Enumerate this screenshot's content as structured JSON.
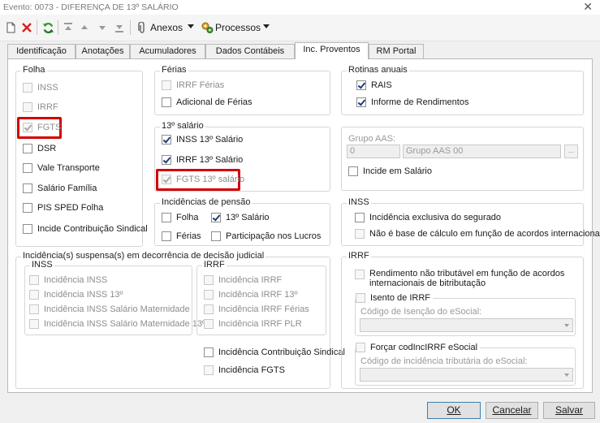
{
  "window": {
    "title": "Evento: 0073 - DIFERENÇA DE 13º SALÁRIO",
    "close_glyph": "✕"
  },
  "toolbar": {
    "new_icon": "new-document-icon",
    "delete_icon": "delete-x-icon",
    "refresh_icon": "refresh-icon",
    "first_icon": "first-record-icon",
    "prev_icon": "previous-record-icon",
    "next_icon": "next-record-icon",
    "last_icon": "last-record-icon",
    "anexos_label": "Anexos",
    "processos_label": "Processos"
  },
  "tabs": [
    {
      "label": "Identificação",
      "active": false
    },
    {
      "label": "Anotações",
      "active": false
    },
    {
      "label": "Acumuladores",
      "active": false
    },
    {
      "label": "Dados Contábeis",
      "active": false
    },
    {
      "label": "Inc. Proventos",
      "active": true
    },
    {
      "label": "RM Portal",
      "active": false
    }
  ],
  "folha": {
    "title": "Folha",
    "items": [
      {
        "label": "INSS",
        "checked": false,
        "enabled": false
      },
      {
        "label": "IRRF",
        "checked": false,
        "enabled": false
      },
      {
        "label": "FGTS",
        "checked": true,
        "enabled": false,
        "highlighted": true
      },
      {
        "label": "DSR",
        "checked": false,
        "enabled": true
      },
      {
        "label": "Vale Transporte",
        "checked": false,
        "enabled": true
      },
      {
        "label": "Salário Família",
        "checked": false,
        "enabled": true
      },
      {
        "label": "PIS SPED Folha",
        "checked": false,
        "enabled": true
      },
      {
        "label": "Incide Contribuição Sindical",
        "checked": false,
        "enabled": true
      }
    ]
  },
  "ferias": {
    "title": "Férias",
    "items": [
      {
        "label": "IRRF Férias",
        "checked": false,
        "enabled": false
      },
      {
        "label": "Adicional de Férias",
        "checked": false,
        "enabled": true
      }
    ]
  },
  "decimo": {
    "title": "13º salário",
    "items": [
      {
        "label": "INSS 13º Salário",
        "checked": true,
        "enabled": true
      },
      {
        "label": "IRRF 13º Salário",
        "checked": true,
        "enabled": true
      },
      {
        "label": "FGTS 13º salário",
        "checked": true,
        "enabled": false,
        "highlighted": true
      }
    ]
  },
  "pensao": {
    "title": "Incidências de pensão",
    "folha": {
      "label": "Folha",
      "checked": false
    },
    "decimo": {
      "label": "13º Salário",
      "checked": true
    },
    "ferias": {
      "label": "Férias",
      "checked": false
    },
    "plr": {
      "label": "Participação nos Lucros",
      "checked": false
    }
  },
  "rotinas": {
    "title": "Rotinas anuais",
    "items": [
      {
        "label": "RAIS",
        "checked": true
      },
      {
        "label": "Informe de Rendimentos",
        "checked": true
      }
    ]
  },
  "grupo_aas": {
    "title": "Grupo AAS:",
    "code": "0",
    "name": "Grupo AAS 00",
    "lookup_label": "...",
    "incide": {
      "label": "Incide em Salário",
      "checked": false
    }
  },
  "inss": {
    "title": "INSS",
    "items": [
      {
        "label": "Incidência exclusiva do segurado",
        "checked": false,
        "enabled": true
      },
      {
        "label": "Não é base de cálculo em função de acordos internacionais",
        "checked": false,
        "enabled": false
      }
    ]
  },
  "suspensa": {
    "title": "Incidência(s) suspensa(s) em decorrência de decisão judicial",
    "inss_title": "INSS",
    "inss_items": [
      "Incidência INSS",
      "Incidência INSS 13º",
      "Incidência INSS Salário Maternidade",
      "Incidência INSS Salário Maternidade 13º"
    ],
    "irrf_title": "IRRF",
    "irrf_items": [
      "Incidência IRRF",
      "Incidência IRRF 13º",
      "Incidência IRRF Férias",
      "Incidência IRRF PLR"
    ],
    "sindical": "Incidência Contribuição Sindical",
    "fgts": "Incidência FGTS"
  },
  "irrf": {
    "title": "IRRF",
    "rendimento_line1": "Rendimento não tributável em função de acordos",
    "rendimento_line2": "internacionais de bitributação",
    "isento_label": "Isento de IRRF",
    "codigo_isencao_label": "Código de Isenção do eSocial:",
    "forcar_label": "Forçar codIncIRRF eSocial",
    "codigo_incidencia_label": "Código de incidência tributária do eSocial:"
  },
  "buttons": {
    "ok": "OK",
    "cancel": "Cancelar",
    "save": "Salvar"
  },
  "colors": {
    "highlight": "#d40000",
    "panel_border": "#b9b9b9",
    "default_button_border": "#3c7fb1"
  }
}
